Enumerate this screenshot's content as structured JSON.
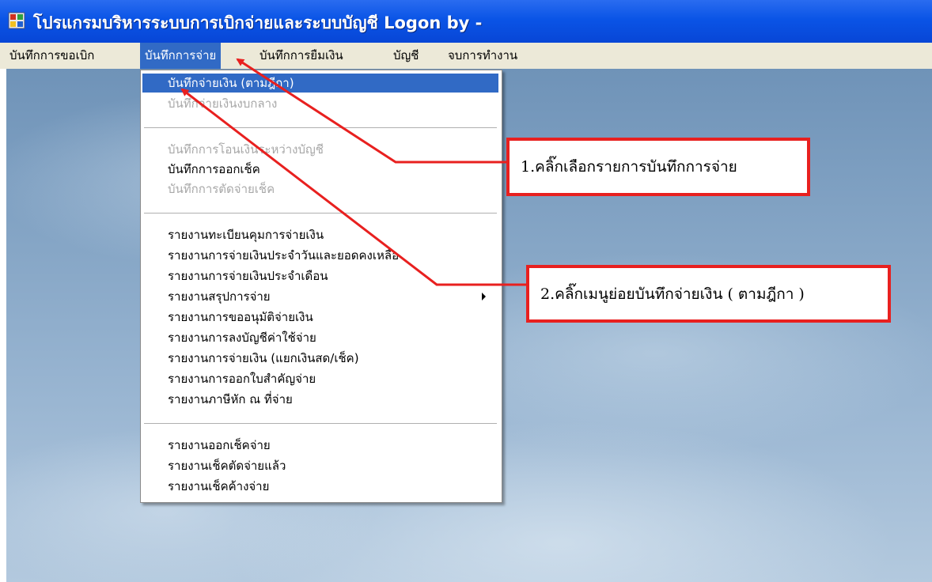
{
  "window": {
    "title": "โปรแกรมบริหารระบบการเบิกจ่ายและระบบบัญชี Logon by -",
    "app_icon": "app-window-icon"
  },
  "menubar": {
    "items": [
      {
        "label": "บันทึกการขอเบิก"
      },
      {
        "label": "บันทึกการจ่าย",
        "active": true
      },
      {
        "label": "บันทึกการยืมเงิน"
      },
      {
        "label": "บัญชี"
      },
      {
        "label": "จบการทำงาน"
      }
    ]
  },
  "dropdown": {
    "items": [
      {
        "label": "บันทึกจ่ายเงิน (ตามฎีกา)",
        "state": "highlighted"
      },
      {
        "label": "บันทึกจ่ายเงินงบกลาง",
        "state": "disabled"
      },
      {
        "label": "บันทึกการโอนเงินระหว่างบัญชี",
        "state": "disabled"
      },
      {
        "label": "บันทึกการออกเช็ค",
        "state": "enabled"
      },
      {
        "label": "บันทึกการตัดจ่ายเช็ค",
        "state": "disabled"
      },
      {
        "label": "รายงานทะเบียนคุมการจ่ายเงิน",
        "state": "enabled"
      },
      {
        "label": "รายงานการจ่ายเงินประจำวันและยอดคงเหลือ",
        "state": "enabled"
      },
      {
        "label": "รายงานการจ่ายเงินประจำเดือน",
        "state": "enabled"
      },
      {
        "label": "รายงานสรุปการจ่าย",
        "state": "enabled",
        "submenu": true
      },
      {
        "label": "รายงานการขออนุมัติจ่ายเงิน",
        "state": "enabled"
      },
      {
        "label": "รายงานการลงบัญชีค่าใช้จ่าย",
        "state": "enabled"
      },
      {
        "label": "รายงานการจ่ายเงิน (แยกเงินสด/เช็ค)",
        "state": "enabled"
      },
      {
        "label": "รายงานการออกใบสำคัญจ่าย",
        "state": "enabled"
      },
      {
        "label": "รายงานภาษีหัก ณ ที่จ่าย",
        "state": "enabled"
      },
      {
        "label": "รายงานออกเช็คจ่าย",
        "state": "enabled"
      },
      {
        "label": "รายงานเช็คตัดจ่ายแล้ว",
        "state": "enabled"
      },
      {
        "label": "รายงานเช็คค้างจ่าย",
        "state": "enabled"
      }
    ],
    "submenu_icon": "triangle-right-icon"
  },
  "annotations": {
    "callout_1": "1.คลิ๊กเลือกรายการบันทึกการจ่าย",
    "callout_2": "2.คลิ๊กเมนูย่อยบันทึกจ่ายเงิน ( ตามฎีกา )",
    "arrow_color": "#e8201f"
  },
  "colors": {
    "titlebar": "#0a54e6",
    "menubar": "#ece9d8",
    "highlight": "#316ac5",
    "disabled_text": "#a8a8a8",
    "callout_border": "#e8201f"
  }
}
